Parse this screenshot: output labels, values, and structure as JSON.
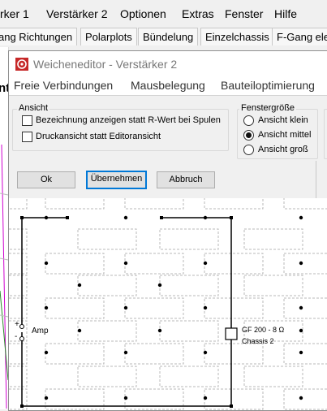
{
  "background_app": {
    "menu": [
      "rker 1",
      "Verstärker 2",
      "Optionen",
      "Extras",
      "Fenster",
      "Hilfe"
    ],
    "tabs": [
      "ang Richtungen",
      "Polarplots",
      "Bündelung",
      "Einzelchassis",
      "F-Gang ele"
    ],
    "left_fragment": "nt"
  },
  "dialog": {
    "title": "Weicheneditor - Verstärker 2",
    "menu": [
      "Freie Verbindungen",
      "Mausbelegung",
      "Bauteiloptimierung"
    ],
    "ansicht_group": {
      "label": "Ansicht",
      "options": [
        {
          "label": "Bezeichnung anzeigen statt R-Wert bei Spulen",
          "checked": false
        },
        {
          "label": "Druckansicht statt Editoransicht",
          "checked": false
        }
      ]
    },
    "fenster_group": {
      "label": "Fenstergröße",
      "options": [
        {
          "label": "Ansicht klein",
          "selected": false
        },
        {
          "label": "Ansicht mittel",
          "selected": true
        },
        {
          "label": "Ansicht groß",
          "selected": false
        }
      ]
    },
    "buttons": {
      "ok": "Ok",
      "apply": "Übernehmen",
      "cancel": "Abbruch"
    },
    "schematic": {
      "amp_label": "Amp",
      "plus": "+",
      "minus": "-",
      "chassis_name": "GF 200 - 8 Ω",
      "chassis_label": "Chassis 2"
    }
  }
}
